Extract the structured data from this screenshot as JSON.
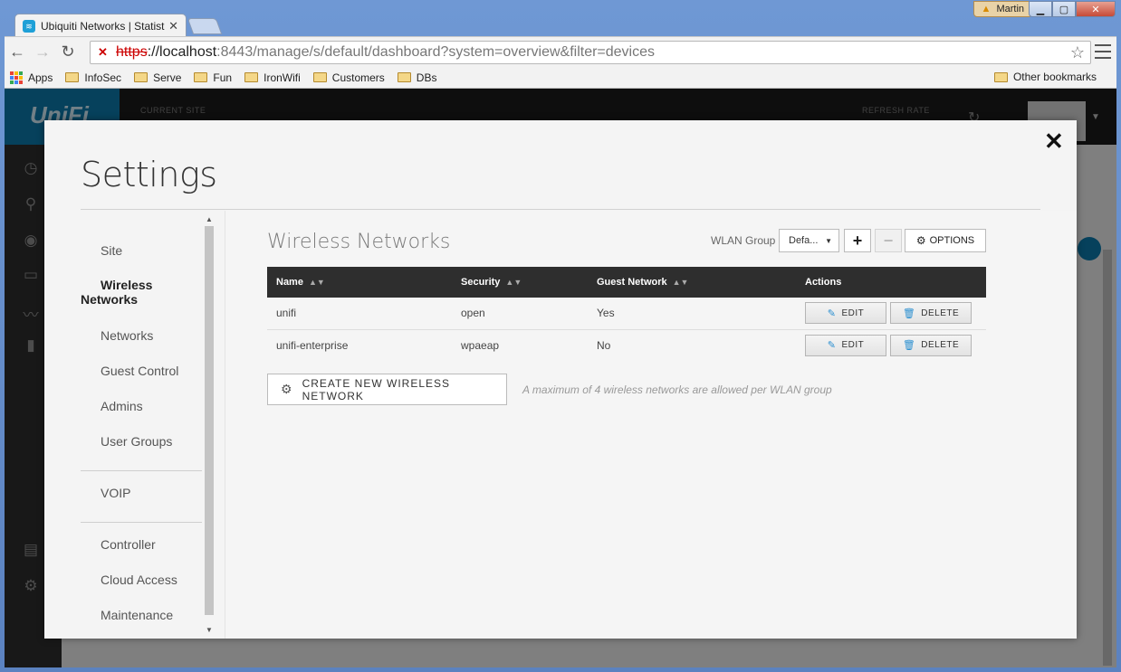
{
  "browser": {
    "tab_title": "Ubiquiti Networks | Statistic",
    "user_name": "Martin",
    "url": {
      "scheme": "https",
      "host": "://localhost",
      "rest": ":8443/manage/s/default/dashboard?system=overview&filter=devices"
    },
    "bookmarks": [
      "Apps",
      "InfoSec",
      "Serve",
      "Fun",
      "IronWifi",
      "Customers",
      "DBs"
    ],
    "other_bookmarks": "Other bookmarks"
  },
  "app_header": {
    "current_site_label": "CURRENT SITE",
    "refresh_rate_label": "REFRESH RATE"
  },
  "settings": {
    "title": "Settings",
    "nav": [
      {
        "label": "Site"
      },
      {
        "label": "Wireless Networks",
        "active": true
      },
      {
        "label": "Networks"
      },
      {
        "label": "Guest Control"
      },
      {
        "label": "Admins"
      },
      {
        "label": "User Groups"
      },
      {
        "label": "VOIP"
      },
      {
        "label": "Controller"
      },
      {
        "label": "Cloud Access"
      },
      {
        "label": "Maintenance"
      }
    ]
  },
  "wireless": {
    "section_title": "Wireless Networks",
    "wlan_group_label": "WLAN Group",
    "wlan_group_value": "Defa...",
    "options_label": "OPTIONS",
    "columns": [
      "Name",
      "Security",
      "Guest Network",
      "Actions"
    ],
    "rows": [
      {
        "name": "unifi",
        "security": "open",
        "guest": "Yes"
      },
      {
        "name": "unifi-enterprise",
        "security": "wpaeap",
        "guest": "No"
      }
    ],
    "edit_label": "EDIT",
    "delete_label": "DELETE",
    "create_label": "CREATE NEW WIRELESS NETWORK",
    "create_note": "A maximum of 4 wireless networks are allowed per WLAN group"
  }
}
